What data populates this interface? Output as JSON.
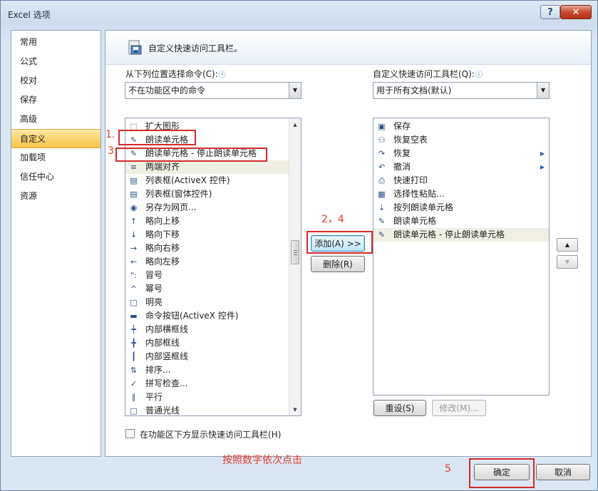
{
  "window": {
    "title": "Excel 选项",
    "help": "?",
    "close": "✕"
  },
  "nav": {
    "items": [
      "常用",
      "公式",
      "校对",
      "保存",
      "高级",
      "自定义",
      "加载项",
      "信任中心",
      "资源"
    ],
    "active_index": 5
  },
  "header": {
    "title": "自定义快速访问工具栏。"
  },
  "left": {
    "label": "从下列位置选择命令(C):",
    "info": "ⓘ",
    "combo_value": "不在功能区中的命令",
    "items": [
      {
        "text": "扩大图形",
        "icon": "expand-shape-icon",
        "glyph": "⬚"
      },
      {
        "text": "朗读单元格",
        "icon": "speak-cells-icon",
        "glyph": "✎"
      },
      {
        "text": "朗读单元格 - 停止朗读单元格",
        "icon": "stop-speak-icon",
        "glyph": "✎"
      },
      {
        "text": "两端对齐",
        "icon": "justify-icon",
        "glyph": "≡"
      },
      {
        "text": "列表框(ActiveX 控件)",
        "icon": "listbox-activex-icon",
        "glyph": "▤"
      },
      {
        "text": "列表框(窗体控件)",
        "icon": "listbox-form-icon",
        "glyph": "▤"
      },
      {
        "text": "另存为网页...",
        "icon": "save-web-icon",
        "glyph": "◉"
      },
      {
        "text": "略向上移",
        "icon": "nudge-up-icon",
        "glyph": "↑"
      },
      {
        "text": "略向下移",
        "icon": "nudge-down-icon",
        "glyph": "↓"
      },
      {
        "text": "略向右移",
        "icon": "nudge-right-icon",
        "glyph": "→"
      },
      {
        "text": "略向左移",
        "icon": "nudge-left-icon",
        "glyph": "←"
      },
      {
        "text": "冒号",
        "icon": "colon-icon",
        "glyph": "\":"
      },
      {
        "text": "幂号",
        "icon": "power-icon",
        "glyph": "^"
      },
      {
        "text": "明亮",
        "icon": "bright-icon",
        "glyph": "□"
      },
      {
        "text": "命令按钮(ActiveX 控件)",
        "icon": "command-button-icon",
        "glyph": "▬"
      },
      {
        "text": "内部横框线",
        "icon": "inner-horizontal-border-icon",
        "glyph": "┿"
      },
      {
        "text": "内部框线",
        "icon": "inner-border-icon",
        "glyph": "╋"
      },
      {
        "text": "内部竖框线",
        "icon": "inner-vertical-border-icon",
        "glyph": "┃"
      },
      {
        "text": "排序...",
        "icon": "sort-icon",
        "glyph": "⇅"
      },
      {
        "text": "拼写检查...",
        "icon": "spell-check-icon",
        "glyph": "✓"
      },
      {
        "text": "平行",
        "icon": "parallel-icon",
        "glyph": "∥"
      },
      {
        "text": "普通光线",
        "icon": "normal-light-icon",
        "glyph": "□"
      }
    ],
    "selected_index": 3,
    "checkbox_label": "在功能区下方显示快速访问工具栏(H)"
  },
  "middle": {
    "add_button": "添加(A) >>",
    "remove_button": "删除(R)"
  },
  "right": {
    "label": "自定义快速访问工具栏(Q):",
    "info": "ⓘ",
    "combo_value": "用于所有文档(默认)",
    "items": [
      {
        "text": "保存",
        "icon": "save-icon",
        "glyph": "▣",
        "sub": ""
      },
      {
        "text": "恢复空表",
        "icon": "restore-table-icon",
        "glyph": "⚇",
        "sub": ""
      },
      {
        "text": "恢复",
        "icon": "redo-icon",
        "glyph": "↷",
        "sub": "▶"
      },
      {
        "text": "撤消",
        "icon": "undo-icon",
        "glyph": "↶",
        "sub": "▶"
      },
      {
        "text": "快速打印",
        "icon": "quick-print-icon",
        "glyph": "⎙",
        "sub": ""
      },
      {
        "text": "选择性粘贴...",
        "icon": "paste-special-icon",
        "glyph": "▦",
        "sub": ""
      },
      {
        "text": "按列朗读单元格",
        "icon": "speak-by-columns-icon",
        "glyph": "⇣",
        "sub": ""
      },
      {
        "text": "朗读单元格",
        "icon": "speak-cells-icon",
        "glyph": "✎",
        "sub": ""
      },
      {
        "text": "朗读单元格 - 停止朗读单元格",
        "icon": "stop-speak-icon",
        "glyph": "✎",
        "sub": ""
      }
    ],
    "selected_index": 8,
    "reset_button": "重设(S)",
    "modify_button": "修改(M)...",
    "move_up": "▲",
    "move_down": "▼"
  },
  "footer": {
    "ok_button": "确定",
    "cancel_button": "取消"
  },
  "annotations": {
    "step1": "1.",
    "step3": "3",
    "step24": "2，4",
    "step5": "5",
    "hint": "按照数字依次点击",
    "color": "#e03c2c"
  }
}
